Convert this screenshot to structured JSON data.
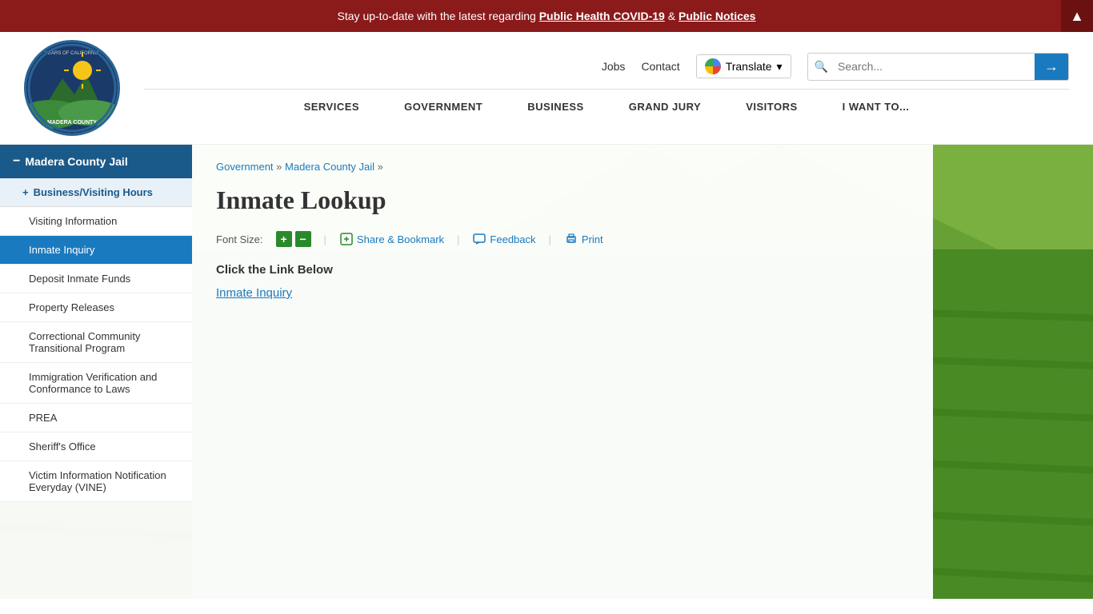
{
  "alert": {
    "text": "Stay up-to-date with  the latest regarding ",
    "link1": "Public Health COVID-19",
    "connector": " & ",
    "link2": "Public Notices"
  },
  "header": {
    "logo_text": "MADERA\nCOUNTY",
    "nav_links": [
      {
        "label": "Jobs"
      },
      {
        "label": "Contact"
      }
    ],
    "translate_label": "Translate",
    "search_placeholder": "Search...",
    "nav_items": [
      {
        "label": "SERVICES"
      },
      {
        "label": "GOVERNMENT"
      },
      {
        "label": "BUSINESS"
      },
      {
        "label": "GRAND JURY"
      },
      {
        "label": "VISITORS"
      },
      {
        "label": "I WANT TO..."
      }
    ]
  },
  "sidebar": {
    "main_item": "Madera County Jail",
    "sub_item": "Business/Visiting Hours",
    "items": [
      {
        "label": "Visiting Information",
        "active": false
      },
      {
        "label": "Inmate Inquiry",
        "active": true
      },
      {
        "label": "Deposit Inmate Funds",
        "active": false
      },
      {
        "label": "Property Releases",
        "active": false
      },
      {
        "label": "Correctional Community Transitional Program",
        "active": false
      },
      {
        "label": "Immigration Verification and Conformance to Laws",
        "active": false
      },
      {
        "label": "PREA",
        "active": false
      },
      {
        "label": "Sheriff's Office",
        "active": false
      },
      {
        "label": "Victim Information Notification Everyday (VINE)",
        "active": false
      }
    ]
  },
  "breadcrumb": {
    "items": [
      {
        "label": "Government",
        "href": "#"
      },
      {
        "label": "Madera County Jail",
        "href": "#"
      }
    ]
  },
  "page": {
    "title": "Inmate Lookup",
    "font_size_label": "Font Size:",
    "increase_label": "+",
    "decrease_label": "−",
    "share_label": "Share & Bookmark",
    "feedback_label": "Feedback",
    "print_label": "Print",
    "content_text": "Click the Link Below",
    "inmate_link": "Inmate Inquiry"
  }
}
